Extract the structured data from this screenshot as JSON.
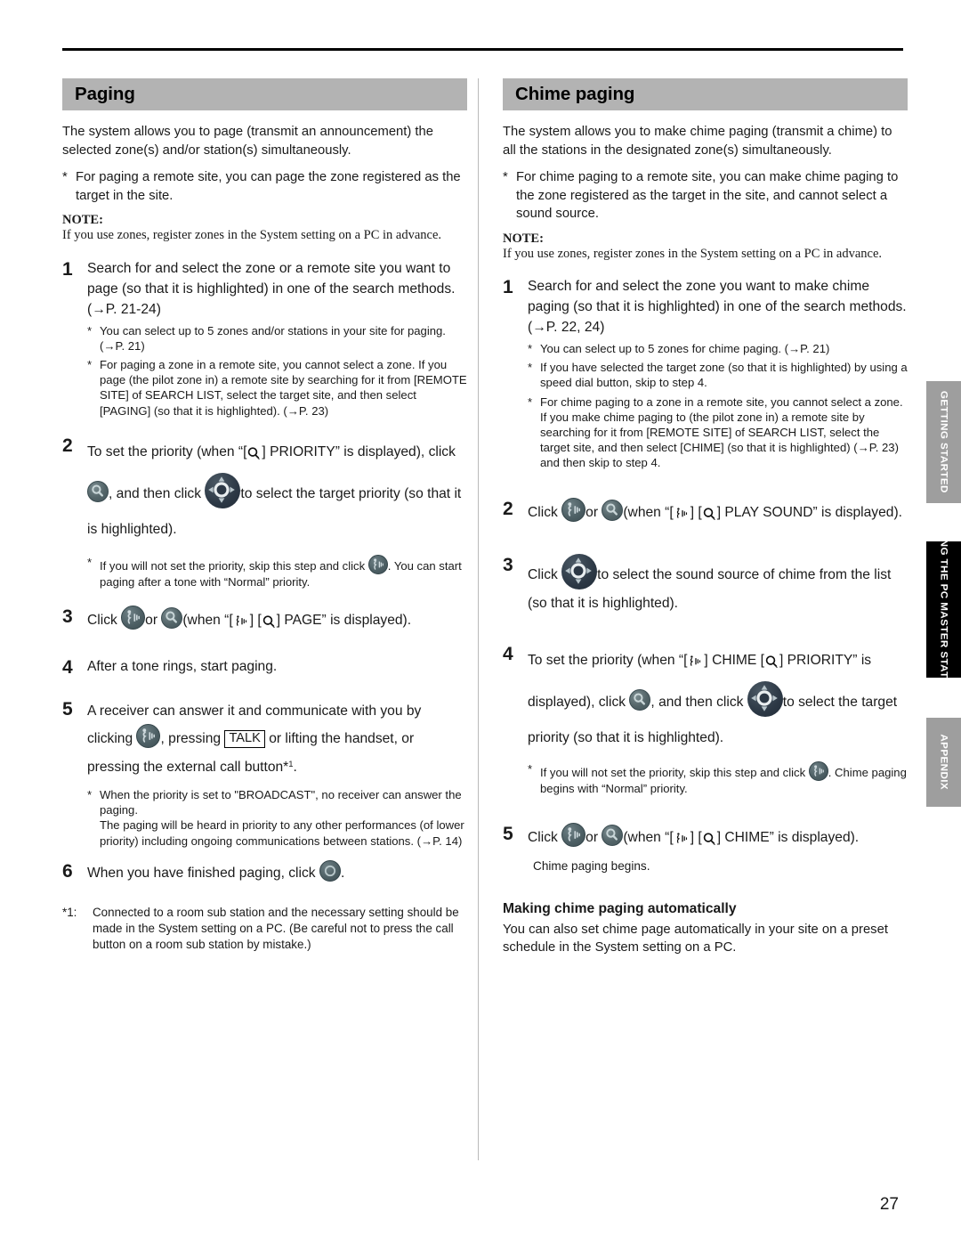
{
  "page": {
    "number": "27"
  },
  "side_tabs": [
    {
      "label": "GETTING STARTED",
      "state": "inactive",
      "color": "#9e9e9e"
    },
    {
      "label": "USING THE PC MASTER STATION",
      "state": "active",
      "color": "#000000"
    },
    {
      "label": "APPENDIX",
      "state": "inactive",
      "color": "#9e9e9e"
    }
  ],
  "left": {
    "heading": "Paging",
    "intro": "The system allows you to page (transmit an announcement) the selected zone(s) and/or station(s) simultaneously.",
    "intro_bullet": "For paging a remote site, you can page the zone registered as the target in the site.",
    "note_label": "NOTE:",
    "note_text": "If you use zones, register zones in the System setting on a PC in advance.",
    "steps": [
      {
        "num": "1",
        "text": "Search for and select the zone or a remote site you want to page (so that it is highlighted) in one of the search methods. (→P. 21-24)",
        "subs": [
          "You can select up to 5 zones and/or stations in your site for paging. (→P. 21)",
          "For paging a zone in a remote site, you cannot select a zone. If you page (the pilot zone in) a remote site by searching for it from [REMOTE SITE] of SEARCH LIST, select the target site, and then select [PAGING] (so that it is highlighted). (→P. 23)"
        ]
      },
      {
        "num": "2",
        "text_a": "To set the priority (when “[",
        "text_b": "] PRIORITY” is displayed), click",
        "text_c": ", and then click",
        "text_d": "to select the target priority (so that it is highlighted).",
        "sub_a": "If you will not set the priority, skip this step and click",
        "sub_b": ". You can start paging after a tone with “Normal” priority."
      },
      {
        "num": "3",
        "text_a": "Click",
        "text_b": "or",
        "text_c": "(when “[",
        "text_d": "] [",
        "text_e": "] PAGE” is displayed)."
      },
      {
        "num": "4",
        "text": "After a tone rings, start paging."
      },
      {
        "num": "5",
        "text_a": "A receiver can answer it and communicate with you by clicking",
        "text_b": ", pressing",
        "talk_key": "TALK",
        "text_c": "or lifting the handset, or pressing the external call button*",
        "text_sup": "1",
        "text_d": ".",
        "sub": "When the priority is set to \"BROADCAST\", no receiver can answer the paging.\nThe paging will be heard in priority to any other performances (of lower priority) including ongoing communications between stations. (→P. 14)"
      },
      {
        "num": "6",
        "text_a": "When you have finished paging, click",
        "text_b": "."
      }
    ],
    "footnote": {
      "key": "*1:",
      "text": "Connected to a room sub station and the necessary setting should be made in the System setting on a PC. (Be careful not to press the call button on a room sub station by mistake.)"
    }
  },
  "right": {
    "heading": "Chime paging",
    "intro": "The system allows you to make chime paging (transmit a chime) to all the stations in the designated zone(s) simultaneously.",
    "intro_bullet": "For chime paging to a remote site, you can make chime paging to the zone registered as the target in the site, and cannot select a sound source.",
    "note_label": "NOTE:",
    "note_text": "If you use zones, register zones in the System setting on a PC in advance.",
    "steps": [
      {
        "num": "1",
        "text": "Search for and select the zone you want to make chime paging (so that it is highlighted) in one of the search methods. (→P. 22, 24)",
        "subs": [
          "You can select up to 5 zones for chime paging. (→P. 21)",
          "If you have selected the target zone (so that it is highlighted) by using a speed dial button, skip to step 4.",
          "For chime paging to a zone in a remote site, you cannot select a zone. If you make chime paging to (the pilot zone in) a remote site by searching for it from [REMOTE SITE] of SEARCH LIST, select the target site, and then select [CHIME] (so that it is highlighted) (→P. 23) and then skip to step 4."
        ]
      },
      {
        "num": "2",
        "text_a": "Click",
        "text_b": "or",
        "text_c": "(when “[",
        "text_d": "] [",
        "text_e": "] PLAY SOUND” is displayed)."
      },
      {
        "num": "3",
        "text_a": "Click",
        "text_b": "to select the sound source of chime from the list (so that it is highlighted)."
      },
      {
        "num": "4",
        "text_a": "To set the priority (when “[",
        "text_b": "] CHIME [",
        "text_c": "] PRIORITY” is displayed), click",
        "text_d": ", and then click",
        "text_e": "to select the target priority (so that it is highlighted).",
        "sub_a": "If you will not set the priority, skip this step and click",
        "sub_b": ". Chime paging begins with “Normal” priority."
      },
      {
        "num": "5",
        "text_a": "Click",
        "text_b": "or",
        "text_c": "(when “[",
        "text_d": "] [",
        "text_e": "] CHIME” is displayed).",
        "sub_plain": "Chime paging begins."
      }
    ],
    "subsection": {
      "heading": "Making chime paging automatically",
      "text": "You can also set chime page automatically in your site on a preset schedule in the System setting on a PC."
    }
  },
  "icons": {
    "talk_button": "talk-page-button-icon",
    "magnifier_button": "magnifier-button-icon",
    "dpad_button": "dpad-navigation-icon",
    "stop_button": "stop-off-button-icon",
    "bracket_talk": "bracket-talk-symbol-icon",
    "bracket_magnifier": "bracket-magnifier-symbol-icon"
  },
  "colors": {
    "heading_bar": "#b3b3b3",
    "tab_inactive": "#9e9e9e",
    "tab_active": "#000000",
    "icon_teal": "#4e6065",
    "icon_navy": "#2c3845"
  }
}
